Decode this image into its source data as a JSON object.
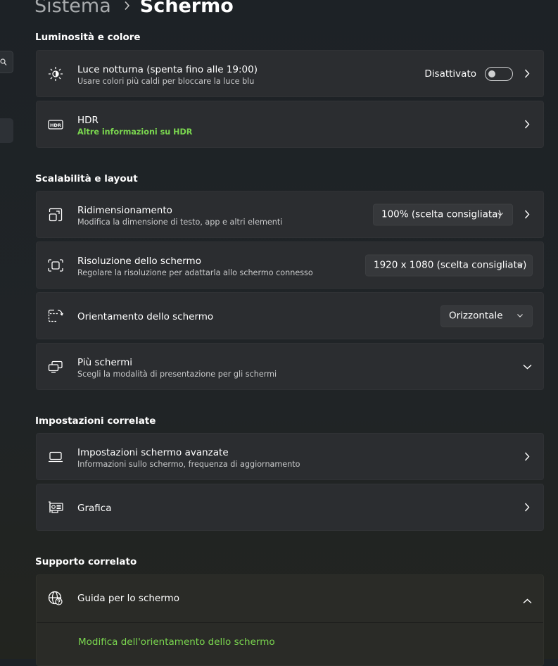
{
  "breadcrumb": {
    "parent": "Sistema",
    "current": "Schermo"
  },
  "sections": {
    "brightness": "Luminosità e colore",
    "scale": "Scalabilità e layout",
    "related": "Impostazioni correlate",
    "support": "Supporto correlato"
  },
  "night_light": {
    "icon": "night-light-icon",
    "title": "Luce notturna (spenta fino alle 19:00)",
    "subtitle": "Usare colori più caldi per bloccare la luce blu",
    "state": "Disattivato",
    "toggle_on": false
  },
  "hdr": {
    "icon": "hdr-icon",
    "title": "HDR",
    "link": "Altre informazioni su HDR"
  },
  "scale": {
    "icon": "scale-icon",
    "title": "Ridimensionamento",
    "subtitle": "Modifica la dimensione di testo, app e altri elementi",
    "value": "100% (scelta consigliata)"
  },
  "resolution": {
    "icon": "resolution-icon",
    "title": "Risoluzione dello schermo",
    "subtitle": "Regolare la risoluzione per adattarla allo schermo connesso",
    "value": "1920 x 1080 (scelta consigliata)"
  },
  "orientation": {
    "icon": "orientation-icon",
    "title": "Orientamento dello schermo",
    "value": "Orizzontale"
  },
  "multiple": {
    "icon": "multiple-displays-icon",
    "title": "Più schermi",
    "subtitle": "Scegli la modalità di presentazione per gli schermi"
  },
  "advanced": {
    "icon": "laptop-icon",
    "title": "Impostazioni schermo avanzate",
    "subtitle": "Informazioni sullo schermo, frequenza di aggiornamento"
  },
  "graphics": {
    "icon": "graphics-card-icon",
    "title": "Grafica"
  },
  "support": {
    "icon": "globe-help-icon",
    "title": "Guida per lo schermo",
    "links": [
      "Modifica dell'orientamento dello schermo"
    ]
  },
  "colors": {
    "accent_link": "#7ad64f",
    "card": "#2b2d30"
  }
}
